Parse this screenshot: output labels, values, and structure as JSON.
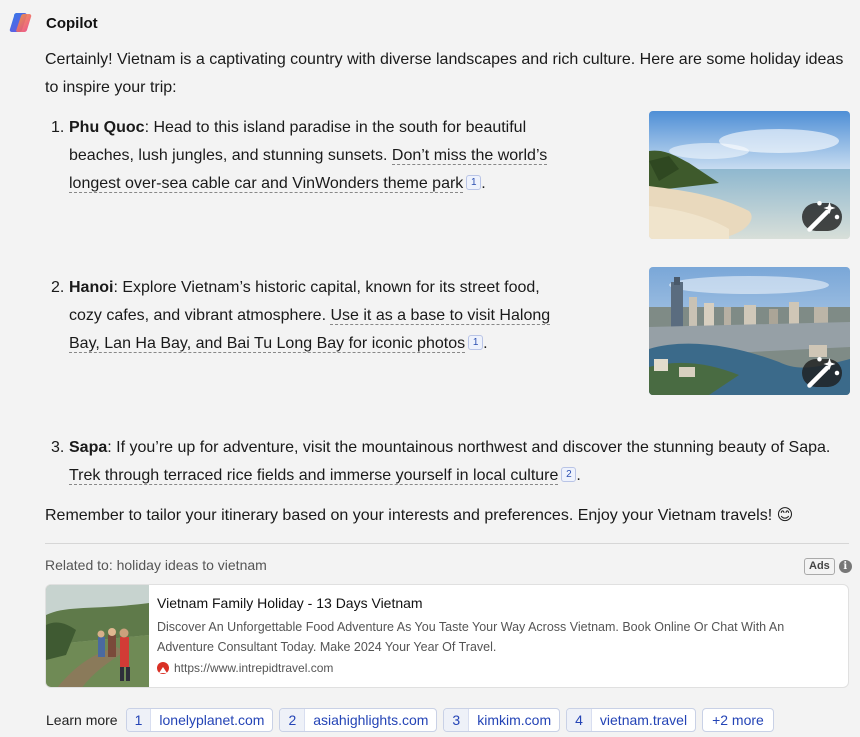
{
  "header": {
    "brand": "Copilot",
    "logo_icon": "copilot-logo-icon"
  },
  "intro": "Certainly! Vietnam is a captivating country with diverse landscapes and rich culture. Here are some holiday ideas to inspire your trip:",
  "items": [
    {
      "num": "1.",
      "title": "Phu Quoc",
      "text": ": Head to this island paradise in the south for beautiful beaches, lush jungles, and stunning sunsets. ",
      "cite_text": "Don’t miss the world’s longest over-sea cable car and VinWonders theme park",
      "cite_num": "1",
      "end": "."
    },
    {
      "num": "2.",
      "title": "Hanoi",
      "text": ": Explore Vietnam’s historic capital, known for its street food, cozy cafes, and vibrant atmosphere. ",
      "cite_text": "Use it as a base to visit Halong Bay, Lan Ha Bay, and Bai Tu Long Bay for iconic photos",
      "cite_num": "1",
      "end": "."
    },
    {
      "num": "3.",
      "title": "Sapa",
      "text": ": If you’re up for adventure, visit the mountainous northwest and discover the stunning beauty of Sapa. ",
      "cite_text": "Trek through terraced rice fields and immerse yourself in local culture",
      "cite_num": "2",
      "end": "."
    }
  ],
  "outro": "Remember to tailor your itinerary based on your interests and preferences. Enjoy your Vietnam travels! 😊",
  "related": {
    "label": "Related to: holiday ideas to vietnam",
    "ads_badge": "Ads",
    "info_glyph": "i"
  },
  "ad": {
    "title": "Vietnam Family Holiday - 13 Days Vietnam",
    "description": "Discover An Unforgettable Food Adventure As You Taste Your Way Across Vietnam. Book Online Or Chat With An Adventure Consultant Today. Make 2024 Your Year Of Travel.",
    "url": "https://www.intrepidtravel.com"
  },
  "learn_more": {
    "label": "Learn more",
    "sources": [
      {
        "index": "1",
        "host": "lonelyplanet.com"
      },
      {
        "index": "2",
        "host": "asiahighlights.com"
      },
      {
        "index": "3",
        "host": "kimkim.com"
      },
      {
        "index": "4",
        "host": "vietnam.travel"
      }
    ],
    "more": "+2 more"
  },
  "colors": {
    "link": "#2444b6",
    "background": "#f3f3f3",
    "card": "#ffffff"
  }
}
